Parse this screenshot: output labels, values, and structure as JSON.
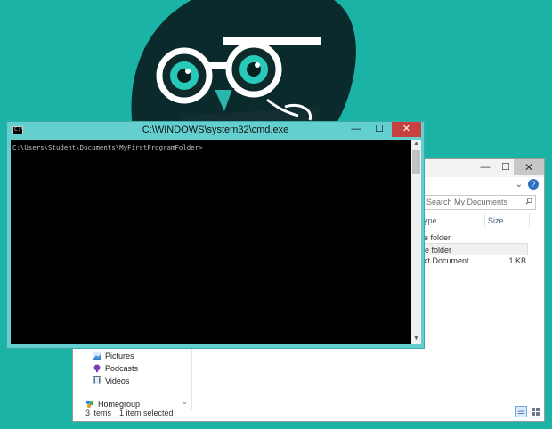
{
  "cmd": {
    "title": "C:\\WINDOWS\\system32\\cmd.exe",
    "icon_text": "C:\\",
    "prompt": "C:\\Users\\Student\\Documents\\MyFirstProgramFolder>",
    "buttons": {
      "minimize": "—",
      "maximize": "☐",
      "close": "✕"
    },
    "scroll_up": "▲",
    "scroll_down": "▼"
  },
  "explorer": {
    "buttons": {
      "minimize": "—",
      "maximize": "☐",
      "close": "✕"
    },
    "address_chevron": "⌄",
    "help": "?",
    "search_placeholder": "Search My Documents",
    "columns": {
      "type": "ype",
      "size": "Size"
    },
    "rows": [
      {
        "type": "e folder",
        "size": ""
      },
      {
        "type": "e folder",
        "size": ""
      },
      {
        "type": "xt Document",
        "size": "1 KB"
      }
    ],
    "nav": [
      {
        "label": "Pictures",
        "icon": "pictures-icon"
      },
      {
        "label": "Podcasts",
        "icon": "podcasts-icon"
      },
      {
        "label": "Videos",
        "icon": "videos-icon"
      },
      {
        "label": "Homegroup",
        "icon": "homegroup-icon"
      }
    ],
    "nav_scroll_down": "⌄",
    "status_items": "3 items",
    "status_selected": "1 item selected"
  },
  "colors": {
    "desktop_bg": "#1ab3a6",
    "cmd_frame": "#63cfcf",
    "close_red": "#c7413e",
    "console_bg": "#000000",
    "console_text": "#c0c0c0"
  }
}
